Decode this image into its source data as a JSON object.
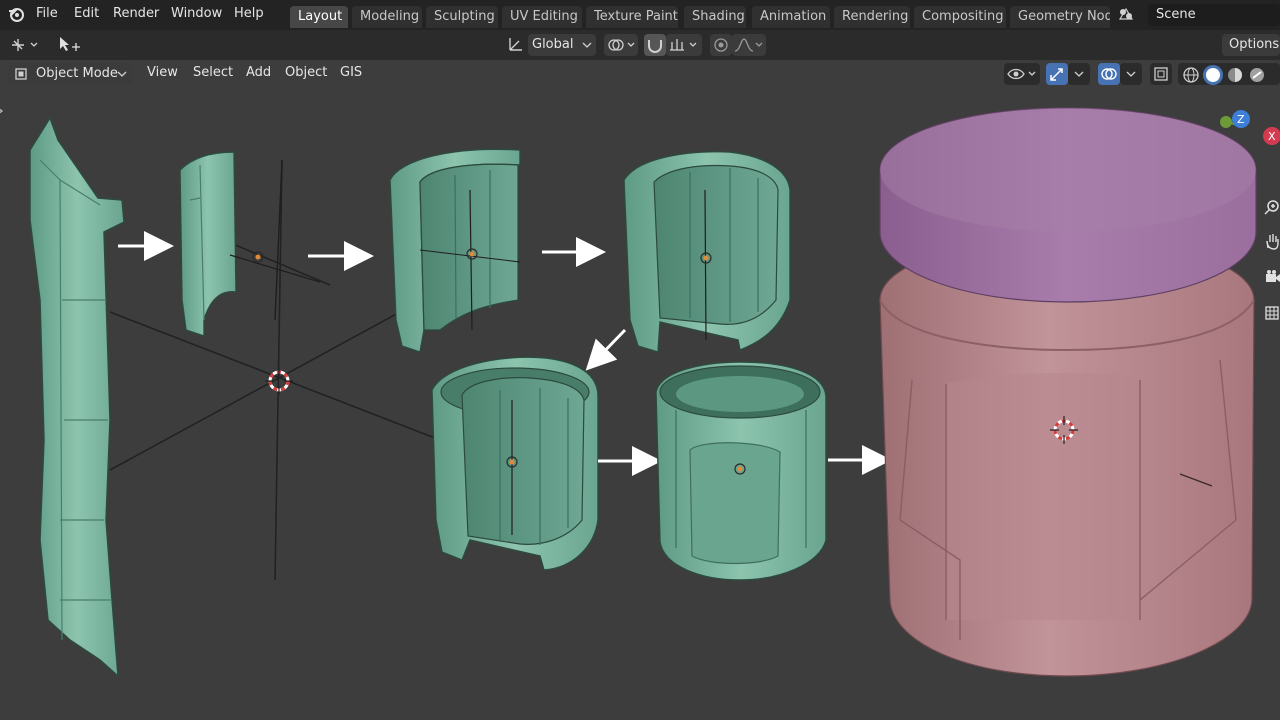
{
  "top_menu": {
    "items": [
      "File",
      "Edit",
      "Render",
      "Window",
      "Help"
    ]
  },
  "workspace_tabs": [
    "Layout",
    "Modeling",
    "Sculpting",
    "UV Editing",
    "Texture Paint",
    "Shading",
    "Animation",
    "Rendering",
    "Compositing",
    "Geometry Nod"
  ],
  "active_tab": "Layout",
  "scene": {
    "name": "Scene"
  },
  "tool_header": {
    "transform_orientation": "Global",
    "options_label": "Options"
  },
  "viewport_header": {
    "mode": "Object Mode",
    "menus": [
      "View",
      "Select",
      "Add",
      "Object",
      "GIS"
    ]
  },
  "gizmo": {
    "z_label": "Z",
    "x_label": "X"
  },
  "colors": {
    "mesh_green": "#7fb7a1",
    "mesh_pink": "#b4868a",
    "mesh_purple": "#9b6f9e",
    "background": "#3d3d3d"
  }
}
